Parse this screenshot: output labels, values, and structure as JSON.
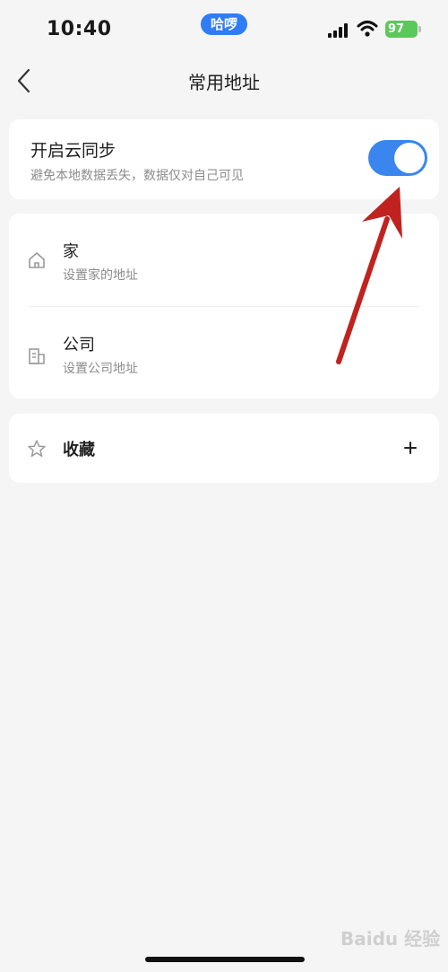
{
  "status_bar": {
    "time": "10:40",
    "app_badge": "哈啰",
    "battery": "97"
  },
  "nav": {
    "title": "常用地址",
    "back_icon": "chevron-left-icon"
  },
  "cloud_sync": {
    "title": "开启云同步",
    "subtitle": "避免本地数据丢失，数据仅对自己可见",
    "enabled": true,
    "accent_color": "#3a86ee"
  },
  "addresses": [
    {
      "title": "家",
      "subtitle": "设置家的地址",
      "icon": "home-icon"
    },
    {
      "title": "公司",
      "subtitle": "设置公司地址",
      "icon": "building-icon"
    }
  ],
  "favorites": {
    "title": "收藏",
    "icon": "star-icon",
    "add_label": "+"
  },
  "annotation": {
    "color": "#c0231f"
  },
  "watermark": "Baidu 经验"
}
